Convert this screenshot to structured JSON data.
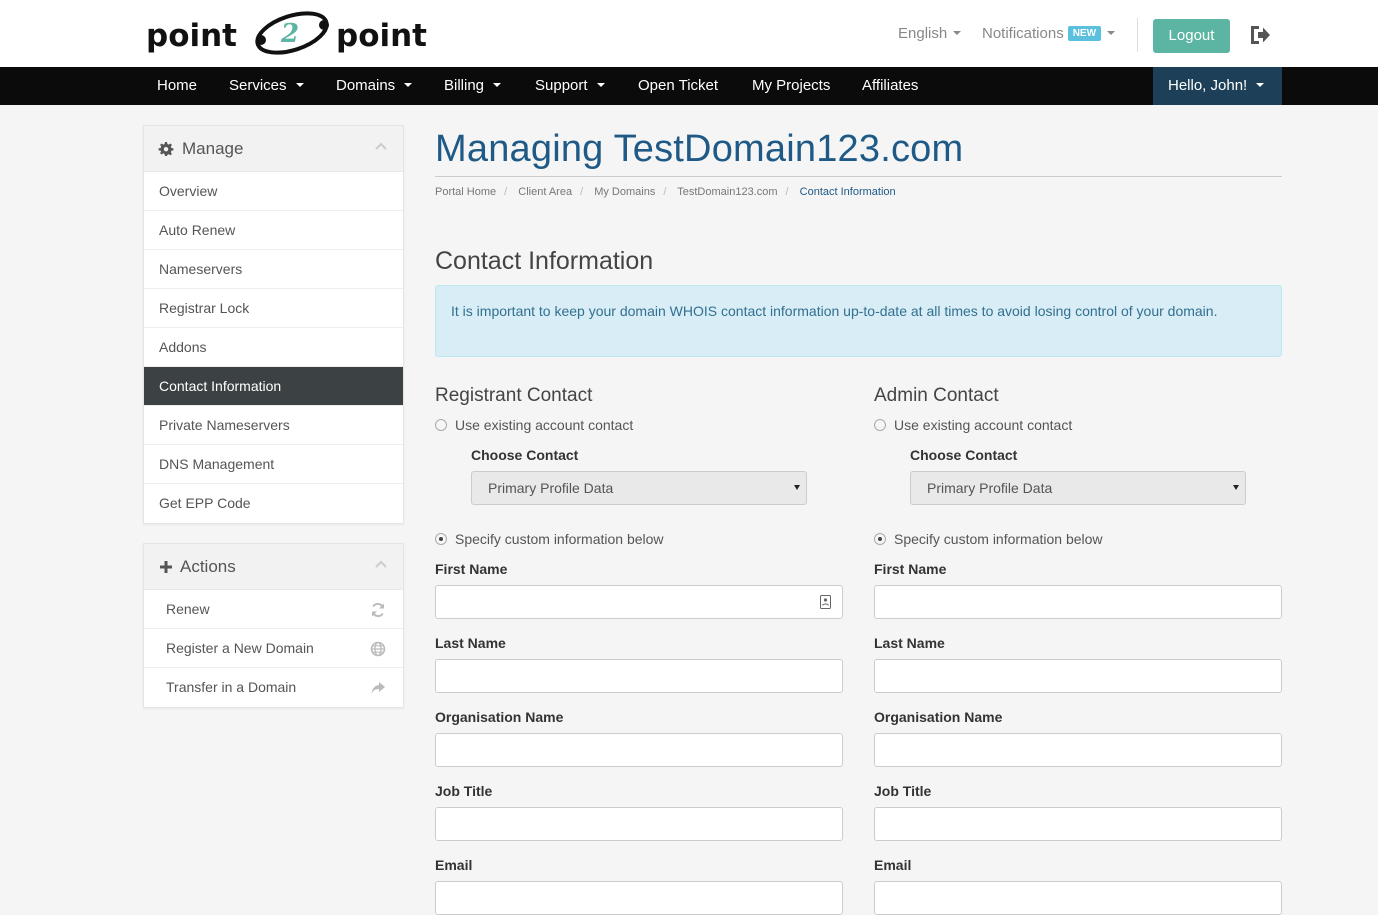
{
  "header": {
    "logo_text": "point 2 point",
    "language": "English",
    "notifications": "Notifications",
    "notifications_badge": "NEW",
    "logout": "Logout"
  },
  "nav": {
    "items": [
      {
        "label": "Home",
        "dropdown": false
      },
      {
        "label": "Services",
        "dropdown": true
      },
      {
        "label": "Domains",
        "dropdown": true
      },
      {
        "label": "Billing",
        "dropdown": true
      },
      {
        "label": "Support",
        "dropdown": true
      },
      {
        "label": "Open Ticket",
        "dropdown": false
      },
      {
        "label": "My Projects",
        "dropdown": false
      },
      {
        "label": "Affiliates",
        "dropdown": false
      }
    ],
    "user": "Hello, John!"
  },
  "sidebar": {
    "manage_title": "Manage",
    "manage_items": [
      "Overview",
      "Auto Renew",
      "Nameservers",
      "Registrar Lock",
      "Addons",
      "Contact Information",
      "Private Nameservers",
      "DNS Management",
      "Get EPP Code"
    ],
    "active_item": "Contact Information",
    "actions_title": "Actions",
    "action_items": [
      {
        "label": "Renew",
        "icon": "refresh-icon"
      },
      {
        "label": "Register a New Domain",
        "icon": "globe-icon"
      },
      {
        "label": "Transfer in a Domain",
        "icon": "share-arrow-icon"
      }
    ]
  },
  "main": {
    "title": "Managing TestDomain123.com",
    "breadcrumb": [
      "Portal Home",
      "Client Area",
      "My Domains",
      "TestDomain123.com",
      "Contact Information"
    ],
    "section_title": "Contact Information",
    "alert": "It is important to keep your domain WHOIS contact information up-to-date at all times to avoid losing control of your domain."
  },
  "contacts": {
    "registrant": {
      "title": "Registrant Contact",
      "use_existing": "Use existing account contact",
      "choose_label": "Choose Contact",
      "choose_value": "Primary Profile Data",
      "custom": "Specify custom information below"
    },
    "admin": {
      "title": "Admin Contact",
      "use_existing": "Use existing account contact",
      "choose_label": "Choose Contact",
      "choose_value": "Primary Profile Data",
      "custom": "Specify custom information below"
    },
    "fields": [
      "First Name",
      "Last Name",
      "Organisation Name",
      "Job Title",
      "Email"
    ]
  },
  "colors": {
    "title_blue": "#1f5a87",
    "logout_green": "#5bb5a2",
    "navbar": "#0b0b0b",
    "user_bg": "#1d4058",
    "active_menu": "#3c4144",
    "alert_bg": "#d9edf7"
  }
}
